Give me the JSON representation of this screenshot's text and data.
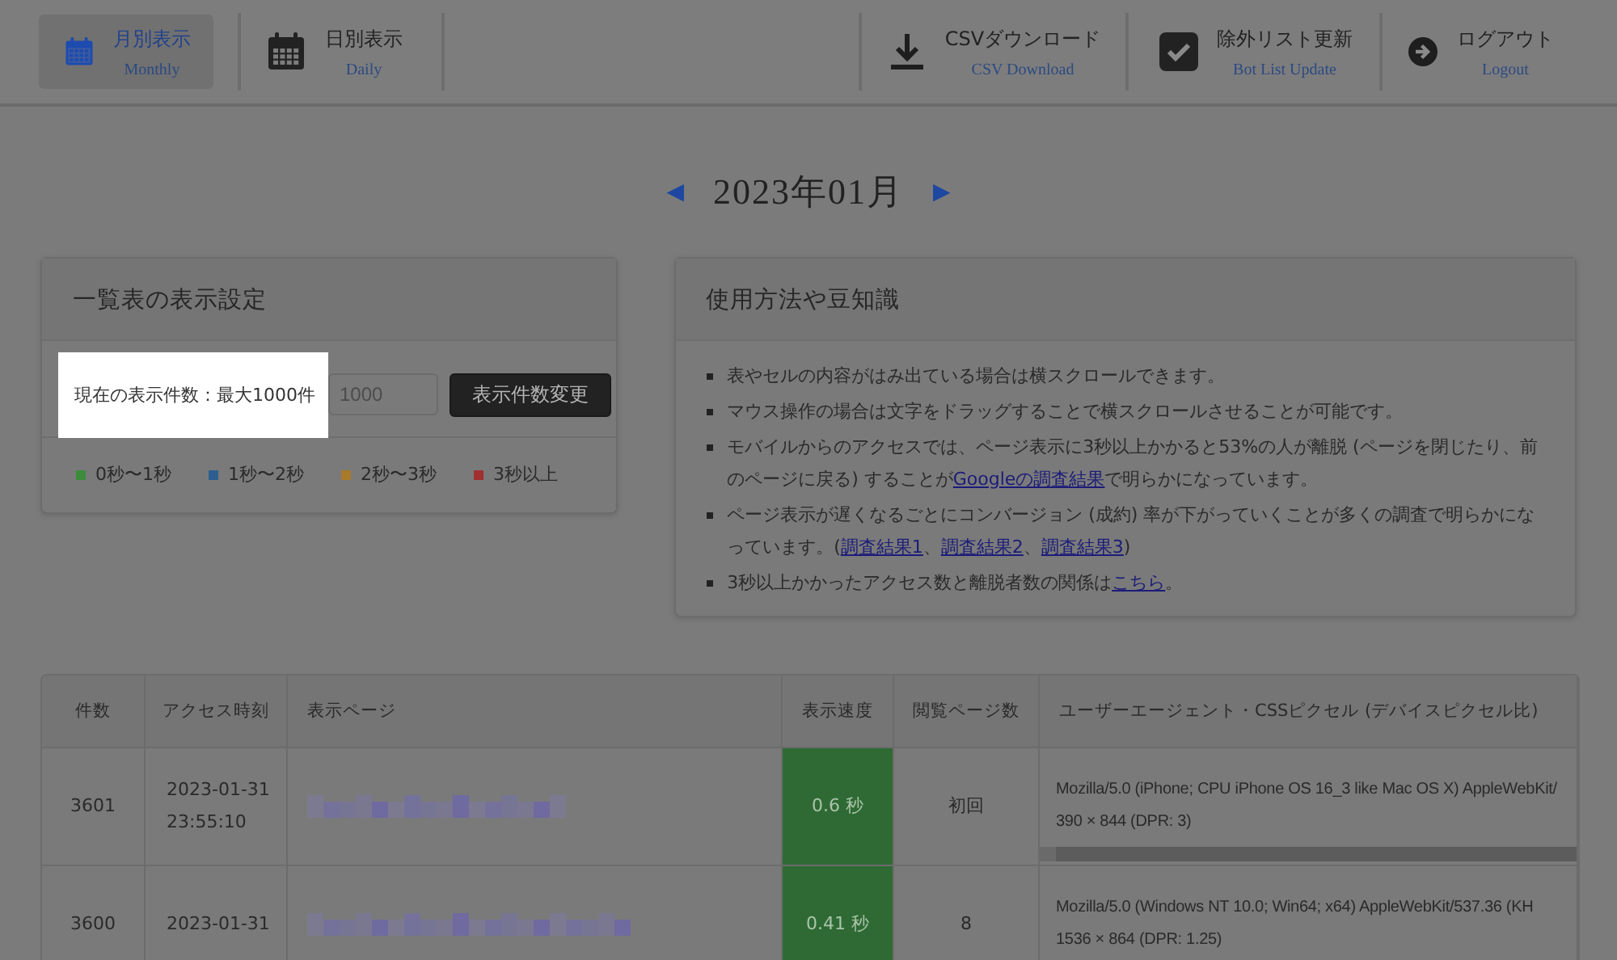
{
  "nav": {
    "left": [
      {
        "label": "月別表示",
        "sub": "Monthly",
        "selected": true
      },
      {
        "label": "日別表示",
        "sub": "Daily",
        "selected": false
      }
    ],
    "right": [
      {
        "label": "CSVダウンロード",
        "sub": "CSV Download"
      },
      {
        "label": "除外リスト更新",
        "sub": "Bot List Update"
      },
      {
        "label": "ログアウト",
        "sub": "Logout"
      }
    ]
  },
  "month": {
    "prev": "◀",
    "title": "2023年01月",
    "next": "▶"
  },
  "settings": {
    "title": "一覧表の表示設定",
    "label": "現在の表示件数：最大1000件",
    "highlighted": true,
    "placeholder": "1000",
    "button": "表示件数変更",
    "legend": [
      {
        "label": "0秒〜1秒",
        "color": "#3c8c3c"
      },
      {
        "label": "1秒〜2秒",
        "color": "#2c5f8f"
      },
      {
        "label": "2秒〜3秒",
        "color": "#a87a2a"
      },
      {
        "label": "3秒以上",
        "color": "#a03030"
      }
    ]
  },
  "tips": {
    "title": "使用方法や豆知識",
    "items": [
      [
        {
          "text": "表やセルの内容がはみ出ている場合は横スクロールできます。"
        }
      ],
      [
        {
          "text": "マウス操作の場合は文字をドラッグすることで横スクロールさせることが可能です。"
        }
      ],
      [
        {
          "text": "モバイルからのアクセスでは、ページ表示に3秒以上かかると53%の人が離脱 (ページを閉じたり、前のページに戻る) することが"
        },
        {
          "link": "Googleの調査結果"
        },
        {
          "text": "で明らかになっています。"
        }
      ],
      [
        {
          "text": "ページ表示が遅くなるごとにコンバージョン (成約) 率が下がっていくことが多くの調査で明らかになっています。("
        },
        {
          "link": "調査結果1"
        },
        {
          "text": "、"
        },
        {
          "link": "調査結果2"
        },
        {
          "text": "、"
        },
        {
          "link": "調査結果3"
        },
        {
          "text": ")"
        }
      ],
      [
        {
          "text": "3秒以上かかったアクセス数と離脱者数の関係は"
        },
        {
          "link": "こちら"
        },
        {
          "text": "。"
        }
      ]
    ]
  },
  "table": {
    "columns": [
      "件数",
      "アクセス時刻",
      "表示ページ",
      "表示速度",
      "閲覧ページ数",
      "ユーザーエージェント・CSSピクセル (デバイスピクセル比)"
    ],
    "rows": [
      {
        "count": "3601",
        "time": [
          "2023-01-31",
          "23:55:10"
        ],
        "speed": "0.6 秒",
        "color": "#2f6a34",
        "pages": "初回",
        "ua": [
          "Mozilla/5.0 (iPhone; CPU iPhone OS 16_3 like Mac OS X) AppleWebKit/",
          "390 × 844  (DPR: 3)"
        ]
      },
      {
        "count": "3600",
        "time": [
          "2023-01-31"
        ],
        "speed": "0.41 秒",
        "color": "#2f6a34",
        "pages": "8",
        "ua": [
          "Mozilla/5.0 (Windows NT 10.0; Win64; x64) AppleWebKit/537.36 (KH",
          "1536 × 864  (DPR: 1.25)"
        ]
      }
    ]
  }
}
